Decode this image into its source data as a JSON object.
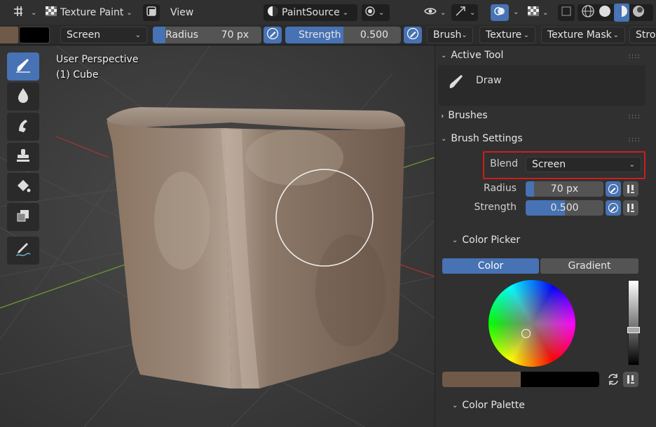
{
  "header": {
    "editor_mode": "Texture Paint",
    "view_menu": "View",
    "paint_source": "PaintSource"
  },
  "toolbar": {
    "primary_color": "#6f5a4a",
    "secondary_color": "#000000",
    "blend_mode": "Screen",
    "radius_label": "Radius",
    "radius_value": "70 px",
    "strength_label": "Strength",
    "strength_value": "0.500",
    "strength_fraction": 0.5,
    "menus": [
      "Brush",
      "Texture",
      "Texture Mask",
      "Stroke"
    ]
  },
  "viewport": {
    "perspective": "User Perspective",
    "object": "(1) Cube",
    "tools": [
      "draw-brush-icon",
      "soften-drop-icon",
      "smear-icon",
      "clone-stamp-icon",
      "fill-bucket-icon",
      "mask-icon",
      "annotate-icon"
    ]
  },
  "panel": {
    "active_tool_title": "Active Tool",
    "active_tool_name": "Draw",
    "brushes_title": "Brushes",
    "brush_settings_title": "Brush Settings",
    "blend_label": "Blend",
    "blend_value": "Screen",
    "radius_label": "Radius",
    "radius_value": "70 px",
    "strength_label": "Strength",
    "strength_value": "0.500",
    "color_picker_title": "Color Picker",
    "tab_color": "Color",
    "tab_gradient": "Gradient",
    "color_palette_title": "Color Palette"
  },
  "colors": {
    "accent": "#4772b3",
    "highlight_box": "#d01c1c",
    "paint_color": "#6f5a4a"
  }
}
